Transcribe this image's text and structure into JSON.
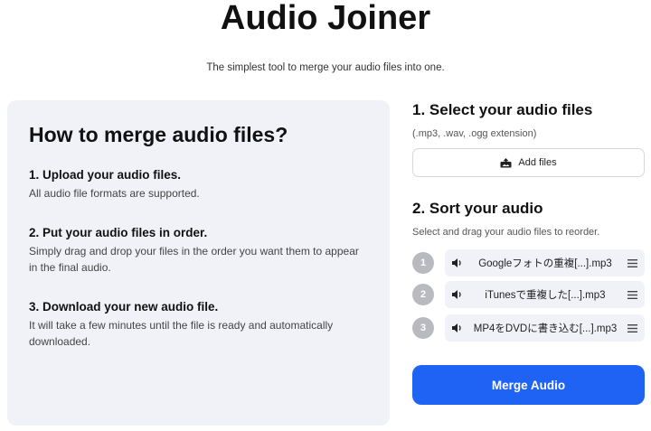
{
  "header": {
    "title": "Audio Joiner",
    "subtitle": "The simplest tool to merge your audio files into one."
  },
  "howto": {
    "heading": "How to merge audio files?",
    "steps": [
      {
        "title": "1. Upload your audio files.",
        "text": "All audio file formats are supported."
      },
      {
        "title": "2. Put your audio files in order.",
        "text": "Simply drag and drop your files in the order you want them to appear in the final audio."
      },
      {
        "title": "3. Download your new audio file.",
        "text": "It will take a few minutes until the file is ready and automatically downloaded."
      }
    ]
  },
  "select": {
    "heading": "1.  Select your audio files",
    "extensions": "(.mp3, .wav, .ogg extension)",
    "add_label": "Add files"
  },
  "sort": {
    "heading": "2.  Sort your audio",
    "instructions": "Select and drag your audio files to reorder.",
    "files": [
      {
        "number": "1",
        "name": "Googleフォトの重複[...].mp3"
      },
      {
        "number": "2",
        "name": "iTunesで重複した[...].mp3"
      },
      {
        "number": "3",
        "name": "MP4をDVDに書き込む[...].mp3"
      }
    ]
  },
  "merge_label": "Merge Audio",
  "colors": {
    "accent": "#1e63f4",
    "panel": "#f1f2f8",
    "badge": "#b9b9c0"
  }
}
